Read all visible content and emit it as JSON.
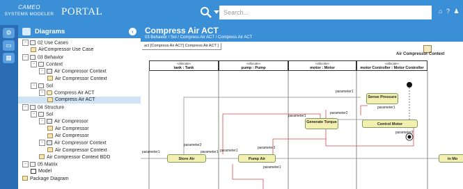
{
  "header": {
    "logo_line1": "CAMEO",
    "logo_line2": "SYSTEMS MODELER",
    "portal": "PORTAL",
    "search_placeholder": "Search...",
    "icons": [
      "home-icon",
      "help-icon",
      "user-icon"
    ],
    "icon_glyphs": [
      "⌂",
      "?",
      "♟"
    ]
  },
  "rail": {
    "icons": [
      "settings-icon",
      "diagrams-icon",
      "model-icon"
    ]
  },
  "sidebar": {
    "title": "Diagrams",
    "items": [
      {
        "label": "02 Use Cases",
        "toggle": "−",
        "icon": "pkg"
      },
      {
        "label": "AirCompressor Use Case",
        "toggle": "",
        "icon": "dg"
      },
      {
        "label": "03 Behavior",
        "toggle": "−",
        "icon": "pkg"
      },
      {
        "label": "Context",
        "toggle": "−",
        "icon": "pkg"
      },
      {
        "label": "Air Compressor Context",
        "toggle": "−",
        "icon": "cl"
      },
      {
        "label": "Air Compressor Context",
        "toggle": "",
        "icon": "dg"
      },
      {
        "label": "Sol",
        "toggle": "−",
        "icon": "pkg"
      },
      {
        "label": "Compress Air ACT",
        "toggle": "−",
        "icon": "ac"
      },
      {
        "label": "Compress Air ACT",
        "toggle": "",
        "icon": "dg"
      },
      {
        "label": "04 Structure",
        "toggle": "−",
        "icon": "pkg"
      },
      {
        "label": "Sol",
        "toggle": "−",
        "icon": "pkg"
      },
      {
        "label": "Air Compressor",
        "toggle": "−",
        "icon": "cl"
      },
      {
        "label": "Air Compressor",
        "toggle": "",
        "icon": "dg"
      },
      {
        "label": "Air Compressor",
        "toggle": "",
        "icon": "dg"
      },
      {
        "label": "Air Compressor Context",
        "toggle": "−",
        "icon": "cl"
      },
      {
        "label": "Air Compressor Context",
        "toggle": "",
        "icon": "dg"
      },
      {
        "label": "Air Compressor Context BDD",
        "toggle": "",
        "icon": "dg"
      },
      {
        "label": "05 Matrix",
        "toggle": "−",
        "icon": "pkg"
      },
      {
        "label": "Model",
        "toggle": "",
        "icon": "mx"
      },
      {
        "label": "Package Diagram",
        "toggle": "",
        "icon": "dg"
      }
    ],
    "selected_index": 8
  },
  "main": {
    "title": "Compress Air ACT",
    "breadcrumb": "03 Behavior / Sol / Compress Air ACT / Compress Air ACT"
  },
  "diagram": {
    "frame_tab": "act [Compress Air ACT] Compress Air ACT ]",
    "context_label": "Air Compressor Context",
    "lanes": [
      {
        "stereotype": "«allocate»",
        "name": "tank : Tank"
      },
      {
        "stereotype": "«allocate»",
        "name": "pump : Pump"
      },
      {
        "stereotype": "«allocate»",
        "name": "motor : Motor"
      },
      {
        "stereotype": "«allocate»",
        "name": "motor Controller : Motor Controller"
      }
    ],
    "actions": [
      "Sense Pressure",
      "Generate Torque",
      "Control Motor",
      "Store Air",
      "Pump Air",
      "in Mo"
    ],
    "param_label": "parameter1",
    "param_label2": "parameter2"
  },
  "colors": {
    "topbar": "#3a8fd6",
    "rail": "#2a6db5",
    "action_fill": "#f3efb0",
    "flow_red": "#e0454a"
  }
}
